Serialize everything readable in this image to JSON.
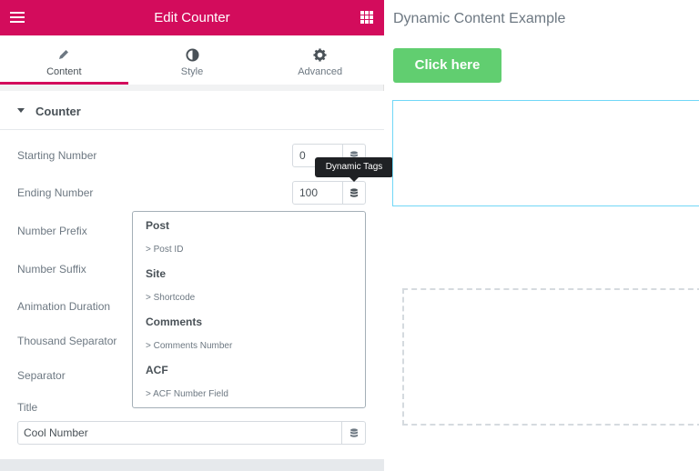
{
  "header": {
    "title": "Edit Counter"
  },
  "tabs": [
    {
      "label": "Content",
      "icon": "pencil-icon",
      "active": true
    },
    {
      "label": "Style",
      "icon": "half-circle-icon",
      "active": false
    },
    {
      "label": "Advanced",
      "icon": "gear-icon",
      "active": false
    }
  ],
  "section": {
    "title": "Counter"
  },
  "controls": {
    "starting_number": {
      "label": "Starting Number",
      "value": "0"
    },
    "ending_number": {
      "label": "Ending Number",
      "value": "100"
    },
    "number_prefix": {
      "label": "Number Prefix"
    },
    "number_suffix": {
      "label": "Number Suffix"
    },
    "animation_duration": {
      "label": "Animation Duration"
    },
    "thousand_separator": {
      "label": "Thousand Separator"
    },
    "separator": {
      "label": "Separator"
    },
    "title": {
      "label": "Title",
      "value": "Cool Number"
    }
  },
  "tooltip": "Dynamic Tags",
  "dropdown": {
    "groups": [
      {
        "name": "Post",
        "item": "Post ID"
      },
      {
        "name": "Site",
        "item": "Shortcode"
      },
      {
        "name": "Comments",
        "item": "Comments Number"
      },
      {
        "name": "ACF",
        "item": "ACF Number Field"
      }
    ],
    "item_prefix": ">"
  },
  "preview": {
    "title": "Dynamic Content Example",
    "button_label": "Click here"
  },
  "colors": {
    "accent": "#d30c5c",
    "button": "#61ce70",
    "selection": "#71d7f7"
  }
}
